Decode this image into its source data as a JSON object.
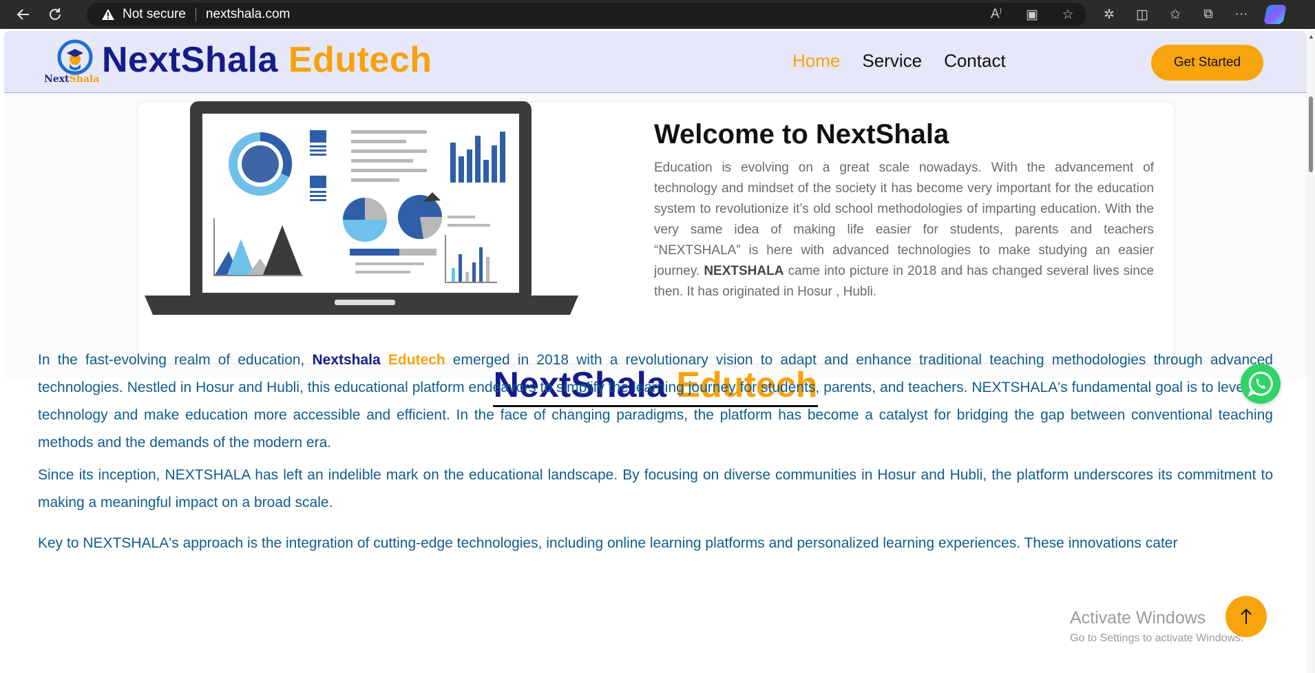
{
  "browser": {
    "not_secure": "Not secure",
    "url": "nextshala.com"
  },
  "header": {
    "brand_part1": "NextShala",
    "brand_part2": "Edutech",
    "logo_text_1": "Next",
    "logo_text_2": "Shala",
    "nav": [
      {
        "label": "Home",
        "active": true
      },
      {
        "label": "Service",
        "active": false
      },
      {
        "label": "Contact",
        "active": false
      }
    ],
    "cta_label": "Get Started"
  },
  "hero": {
    "title": "Welcome to NextShala",
    "text_1": "Education is evolving on a great scale nowadays. With the advancement of technology and mindset of the society it has become very important for the education system to revolutionize it’s old school methodologies of imparting education. With the very same idea of making life easier for students, parents and teachers “NEXTSHALA” is here with advanced technologies to make studying an easier journey.",
    "text_bold": "NEXTSHALA",
    "text_2": " came into picture in 2018 and has changed several lives since then. It has originated in Hosur , Hubli."
  },
  "section": {
    "title_part1": "NextShala",
    "title_part2": "Edutech",
    "para1_a": "In the fast-evolving realm of education, ",
    "para1_hl1": "Nextshala",
    "para1_hl2": "Edutech",
    "para1_b": " emerged in 2018 with a revolutionary vision to adapt and enhance traditional teaching methodologies through advanced technologies. Nestled in Hosur and Hubli, this educational platform endeavors to simplify the learning journey for students, parents, and teachers. NEXTSHALA's fundamental goal is to leverage technology and make education more accessible and efficient. In the face of changing paradigms, the platform has become a catalyst for bridging the gap between conventional teaching methods and the demands of the modern era.",
    "para2": "Since its inception, NEXTSHALA has left an indelible mark on the educational landscape. By focusing on diverse communities in Hosur and Hubli, the platform underscores its commitment to making a meaningful impact on a broad scale.",
    "para3": "Key to NEXTSHALA's approach is the integration of cutting-edge technologies, including online learning platforms and personalized learning experiences. These innovations cater"
  },
  "overlay": {
    "activate_title": "Activate Windows",
    "activate_sub": "Go to Settings to activate Windows."
  },
  "colors": {
    "brand_navy": "#141b8a",
    "brand_orange": "#f7a20c",
    "body_blue": "#0f5c8c",
    "whatsapp_green": "#2fd366"
  }
}
